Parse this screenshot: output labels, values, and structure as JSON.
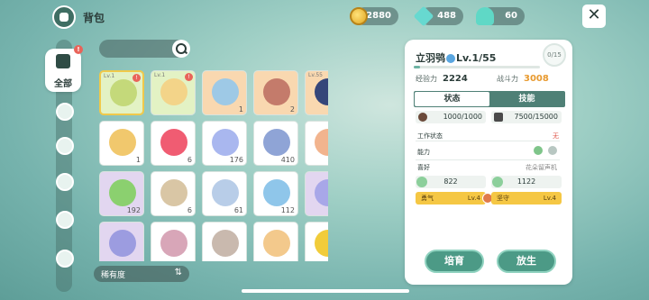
{
  "header": {
    "title": "背包"
  },
  "currencies": [
    {
      "icon": "gold-coin-icon",
      "value": "82880"
    },
    {
      "icon": "teal-gem-icon",
      "value": "488"
    },
    {
      "icon": "heart-gem-icon",
      "value": "60"
    }
  ],
  "sidebar": {
    "items": [
      {
        "label": "全部",
        "icon": "grid-icon",
        "active": true,
        "badge": "!"
      },
      {
        "label": "",
        "icon": "sprout-icon"
      },
      {
        "label": "",
        "icon": "creature-icon"
      },
      {
        "label": "",
        "icon": "creature-icon"
      },
      {
        "label": "",
        "icon": "leaf-icon"
      },
      {
        "label": "",
        "icon": "tree-icon"
      }
    ]
  },
  "grid": {
    "items": [
      {
        "count": "",
        "lv": "Lv.1",
        "dot": "!",
        "tone": "t-green",
        "icon": "creature-icon",
        "color": "#c4d97a",
        "selected": true
      },
      {
        "count": "",
        "lv": "Lv.1",
        "dot": "!",
        "tone": "t-green",
        "icon": "creature-icon",
        "color": "#f3d489"
      },
      {
        "count": "1",
        "lv": "",
        "dot": "",
        "tone": "t-orange",
        "icon": "creature-icon",
        "color": "#9ec9e6"
      },
      {
        "count": "2",
        "lv": "",
        "dot": "",
        "tone": "t-orange",
        "icon": "creature-icon",
        "color": "#c47b6b"
      },
      {
        "count": "",
        "lv": "Lv.55",
        "dot": "!",
        "tone": "t-orange",
        "icon": "creature-icon",
        "color": "#35467a"
      },
      {
        "count": "1",
        "lv": "",
        "dot": "",
        "tone": "t-white",
        "icon": "note-icon",
        "color": "#f1c86d"
      },
      {
        "count": "6",
        "lv": "",
        "dot": "",
        "tone": "t-white",
        "icon": "heart-icon",
        "color": "#f05c72"
      },
      {
        "count": "176",
        "lv": "",
        "dot": "",
        "tone": "t-white",
        "icon": "bottle-icon",
        "color": "#a9b7ef"
      },
      {
        "count": "410",
        "lv": "",
        "dot": "",
        "tone": "t-white",
        "icon": "spray-icon",
        "color": "#8fa4d6"
      },
      {
        "count": "52",
        "lv": "",
        "dot": "",
        "tone": "t-white",
        "icon": "paw-icon",
        "color": "#f2b48e"
      },
      {
        "count": "192",
        "lv": "",
        "dot": "",
        "tone": "t-purple",
        "icon": "leaf-icon",
        "color": "#8bd06f"
      },
      {
        "count": "6",
        "lv": "",
        "dot": "",
        "tone": "t-white",
        "icon": "ticket-icon",
        "color": "#d9c6a5"
      },
      {
        "count": "61",
        "lv": "",
        "dot": "",
        "tone": "t-white",
        "icon": "ticket-icon",
        "color": "#b8cde8"
      },
      {
        "count": "112",
        "lv": "",
        "dot": "",
        "tone": "t-white",
        "icon": "ticket-icon",
        "color": "#8fc6ea"
      },
      {
        "count": "22",
        "lv": "",
        "dot": "",
        "tone": "t-purple",
        "icon": "ticket-icon",
        "color": "#a8a7e8"
      },
      {
        "count": "",
        "lv": "",
        "dot": "",
        "tone": "t-purple",
        "icon": "box-icon",
        "color": "#9c9ce0"
      },
      {
        "count": "",
        "lv": "",
        "dot": "",
        "tone": "t-white",
        "icon": "ticket-icon",
        "color": "#d8a6b8"
      },
      {
        "count": "",
        "lv": "",
        "dot": "",
        "tone": "t-white",
        "icon": "net-icon",
        "color": "#c9b9ae"
      },
      {
        "count": "",
        "lv": "",
        "dot": "",
        "tone": "t-white",
        "icon": "card-icon",
        "color": "#f3c98c"
      },
      {
        "count": "",
        "lv": "",
        "dot": "",
        "tone": "t-white",
        "icon": "bee-icon",
        "color": "#f1cc3a"
      }
    ]
  },
  "sort": {
    "label": "稀有度",
    "icon": "sort-icon"
  },
  "detail": {
    "name": "立羽鸮",
    "level": "Lv.1/55",
    "capacity": "0/15",
    "xp_fraction": 0.05,
    "xp_label": "经验力",
    "xp_value": "2224",
    "power_label": "战斗力",
    "power_value": "3008",
    "tab_status": "状态",
    "tab_skills": "技能",
    "food": "1000/1000",
    "energy": "7500/15000",
    "work_label": "工作状态",
    "work_value": "无",
    "ability_label": "能力",
    "like_label": "喜好",
    "like_value": "花朵留声机",
    "pref1": "822",
    "pref2": "1122",
    "trait1_name": "勇气",
    "trait1_lv": "Lv.4",
    "trait2_name": "坚守",
    "trait2_lv": "Lv.4",
    "btn_train": "培育",
    "btn_release": "放生"
  }
}
